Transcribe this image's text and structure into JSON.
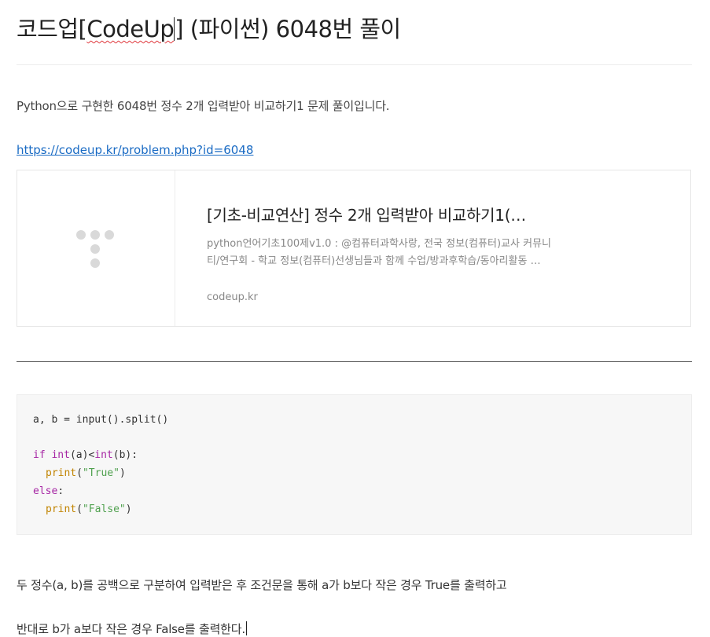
{
  "post": {
    "title_prefix": "코드업[",
    "title_spell": "CodeUp",
    "title_suffix": "] (파이썬) 6048번 풀이",
    "intro": "Python으로 구현한 6048번 정수 2개 입력받아 비교하기1 문제 풀이입니다.",
    "link_url": "https://codeup.kr/problem.php?id=6048"
  },
  "preview_card": {
    "title": "[기초-비교연산] 정수 2개 입력받아 비교하기1(…",
    "description_line1": "python언어기초100제v1.0 : @컴퓨터과학사랑, 전국 정보(컴퓨터)교사 커뮤니",
    "description_line2": "티/연구회 - 학교 정보(컴퓨터)선생님들과 함께 수업/방과후학습/동아리활동 …",
    "host": "codeup.kr"
  },
  "code": {
    "line1": "a, b = input().split()",
    "line3_kw": "if",
    "line3_a": " ",
    "line3_fn1": "int",
    "line3_b": "(a)<",
    "line3_fn2": "int",
    "line3_c": "(b):",
    "line4_fn": "print",
    "line4_open": "(",
    "line4_str": "\"True\"",
    "line4_close": ")",
    "line5_kw": "else",
    "line5_rest": ":",
    "line6_fn": "print",
    "line6_open": "(",
    "line6_str": "\"False\"",
    "line6_close": ")"
  },
  "explanation": {
    "line1": "두 정수(a, b)를 공백으로 구분하여 입력받은 후 조건문을 통해 a가 b보다 작은 경우 True를 출력하고",
    "line2": "반대로 b가 a보다 작은 경우 False를 출력한다."
  }
}
